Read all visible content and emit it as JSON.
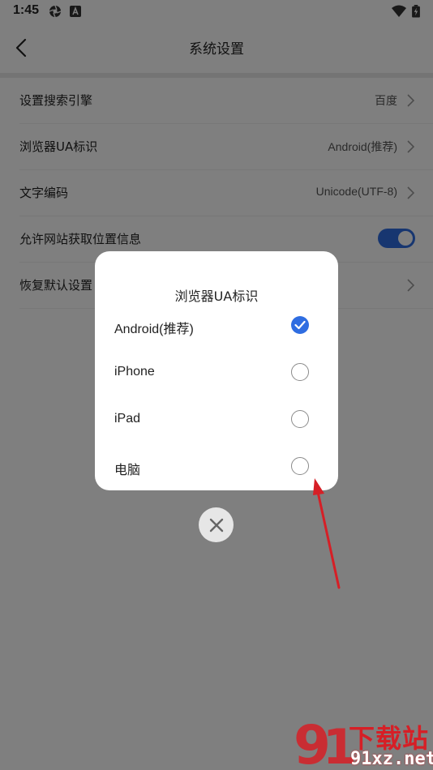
{
  "status_bar": {
    "time": "1:45"
  },
  "header": {
    "title": "系统设置"
  },
  "settings": [
    {
      "label": "设置搜索引擎",
      "value": "百度",
      "type": "link"
    },
    {
      "label": "浏览器UA标识",
      "value": "Android(推荐)",
      "type": "link"
    },
    {
      "label": "文字编码",
      "value": "Unicode(UTF-8)",
      "type": "link"
    },
    {
      "label": "允许网站获取位置信息",
      "value": "",
      "type": "toggle",
      "enabled": true
    },
    {
      "label": "恢复默认设置",
      "value": "",
      "type": "link"
    }
  ],
  "dialog": {
    "title": "浏览器UA标识",
    "options": [
      {
        "label": "Android(推荐)",
        "selected": true
      },
      {
        "label": "iPhone",
        "selected": false
      },
      {
        "label": "iPad",
        "selected": false
      },
      {
        "label": "电脑",
        "selected": false
      }
    ]
  },
  "colors": {
    "accent": "#2f6de1",
    "annotation": "#d61f26"
  },
  "icons": {
    "back": "chevron-left-icon",
    "close": "close-icon",
    "check": "check-icon"
  },
  "watermark": {
    "brand_cn": "下载站",
    "brand_url": "91xz.net"
  }
}
